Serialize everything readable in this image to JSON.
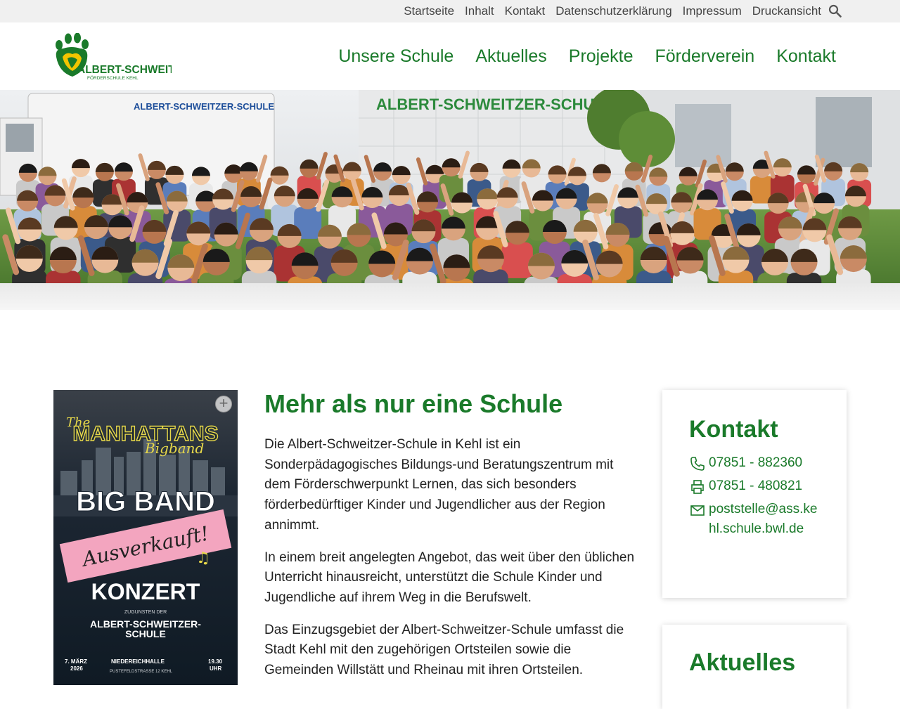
{
  "topbar": {
    "links": [
      "Startseite",
      "Inhalt",
      "Kontakt",
      "Datenschutzerklärung",
      "Impressum",
      "Druckansicht"
    ]
  },
  "logo": {
    "name": "ALBERT-SCHWEITZER",
    "sub": "FÖRDERSCHULE KEHL"
  },
  "mainnav": [
    "Unsere Schule",
    "Aktuelles",
    "Projekte",
    "Förderverein",
    "Kontakt"
  ],
  "hero": {
    "building_sign": "ALBERT-SCHWEITZER-SCHULE",
    "van_sign": "ALBERT-SCHWEITZER-SCHULE"
  },
  "poster": {
    "the": "The",
    "manhattans": "MANHATTANS",
    "bigband": "Bigband",
    "big_band": "BIG BAND",
    "ausverkauft": "Ausverkauft!",
    "konzert": "KONZERT",
    "zugunsten": "ZUGUNSTEN DER",
    "school1": "ALBERT-SCHWEITZER-",
    "school2": "SCHULE",
    "date1": "7. MÄRZ",
    "date2": "2026",
    "venue": "NIEDEREICHHALLE",
    "address": "PUSTEFELDSTRASSE 12 KEHL",
    "time1": "19.30",
    "time2": "UHR"
  },
  "main": {
    "title": "Mehr als nur eine Schule",
    "paragraphs": [
      "Die Albert-Schweitzer-Schule in Kehl ist ein Sonderpädagogisches Bildungs-und Beratungszentrum mit dem Förderschwerpunkt Lernen, das sich besonders förderbedürftiger Kinder und Jugendlicher aus der Region annimmt.",
      "In einem breit angelegten Angebot, das weit über den üblichen Unterricht hinausreicht, unterstützt die Schule Kinder und Jugendliche auf ihrem Weg in die Berufswelt.",
      "Das Einzugsgebiet der Albert-Schweitzer-Schule umfasst die Stadt Kehl mit den zugehörigen Ortsteilen sowie die Gemeinden Willstätt und Rheinau mit ihren Ortsteilen."
    ]
  },
  "contact": {
    "title": "Kontakt",
    "phone": "07851 - 882360",
    "fax": "07851 - 480821",
    "email": "poststelle@ass.kehl.schule.bwl.de"
  },
  "news": {
    "title": "Aktuelles"
  },
  "colors": {
    "brand_green": "#1a7a2a",
    "logo_yellow": "#f2c500",
    "topbar_bg": "#f0f0f0"
  }
}
